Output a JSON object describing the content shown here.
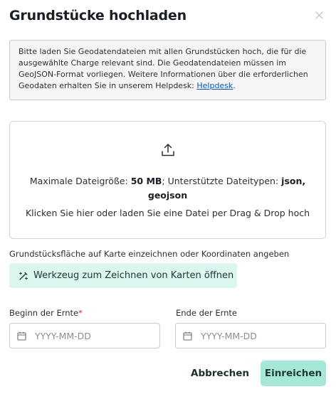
{
  "dialog": {
    "title": "Grundstücke hochladen",
    "close_icon": "close-icon"
  },
  "info": {
    "text": "Bitte laden Sie Geodatendateien mit allen Grundstücken hoch, die für die ausgewählte Charge relevant sind. Die Geodatendateien müssen im GeoJSON-Format vorliegen. Weitere Informationen über die erforderlichen Geodaten erhalten Sie in unserem Helpdesk: ",
    "link_label": "Helpdesk",
    "suffix": "."
  },
  "dropzone": {
    "icon": "upload-icon",
    "max_size_label": "Maximale Dateigröße: ",
    "max_size_value": "50 MB",
    "types_label": "; Unterstützte Dateitypen: ",
    "types_value": "json, geojson",
    "hint": "Klicken Sie hier oder laden Sie eine Datei per Drag & Drop hoch"
  },
  "draw": {
    "label": "Grundstücksfläche auf Karte einzeichnen oder Koordinaten angeben",
    "button_label": "Werkzeug zum Zeichnen von Karten öffnen",
    "icon": "draw-icon"
  },
  "harvest_start": {
    "label": "Beginn der Ernte",
    "required_marker": "*",
    "placeholder": "YYYY-MM-DD"
  },
  "harvest_end": {
    "label": "Ende der Ernte",
    "placeholder": "YYYY-MM-DD"
  },
  "actions": {
    "cancel_label": "Abbrechen",
    "submit_label": "Einreichen"
  },
  "colors": {
    "accent": "#a5e8d8",
    "accent_light": "#dbf6ef",
    "link": "#0b57c2",
    "required": "#d6262b"
  }
}
